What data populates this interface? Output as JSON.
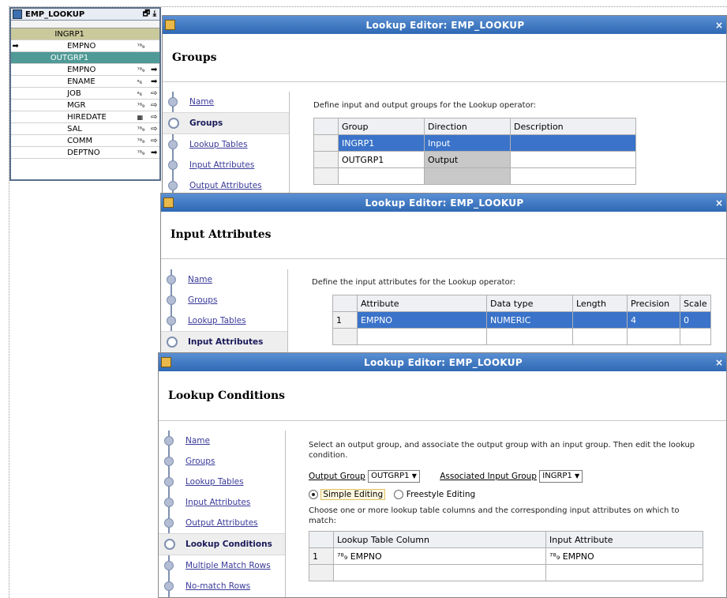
{
  "operator": {
    "title": "EMP_LOOKUP",
    "controls": "🗗 ⤓",
    "rows": [
      {
        "name": "INGRP1",
        "kind": "group-in",
        "type": "",
        "arrow": ""
      },
      {
        "name": "EMPNO",
        "kind": "attr",
        "type": "⁷⁸₉",
        "arrow": "",
        "lead": "➡"
      },
      {
        "name": "OUTGRP1",
        "kind": "group-out",
        "type": "",
        "arrow": ""
      },
      {
        "name": "EMPNO",
        "kind": "attr",
        "type": "⁷⁸₉",
        "arrow": "➡"
      },
      {
        "name": "ENAME",
        "kind": "attr",
        "type": "ᵃ₆",
        "arrow": "➡"
      },
      {
        "name": "JOB",
        "kind": "attr",
        "type": "ᵃ₆",
        "arrow": "⇨"
      },
      {
        "name": "MGR",
        "kind": "attr",
        "type": "⁷⁸₉",
        "arrow": "⇨"
      },
      {
        "name": "HIREDATE",
        "kind": "attr",
        "type": "▦",
        "arrow": "⇨"
      },
      {
        "name": "SAL",
        "kind": "attr",
        "type": "⁷⁸₉",
        "arrow": "⇨"
      },
      {
        "name": "COMM",
        "kind": "attr",
        "type": "⁷⁸₉",
        "arrow": "⇨"
      },
      {
        "name": "DEPTNO",
        "kind": "attr",
        "type": "⁷⁸₉",
        "arrow": "➡"
      }
    ]
  },
  "editor1": {
    "title": "Lookup Editor: EMP_LOOKUP",
    "heading": "Groups",
    "nav": [
      "Name",
      "Groups",
      "Lookup Tables",
      "Input Attributes",
      "Output Attributes"
    ],
    "selected": "Groups",
    "description": "Define input and output groups for the Lookup operator:",
    "columns": [
      "Group",
      "Direction",
      "Description"
    ],
    "rows": [
      {
        "group": "INGRP1",
        "direction": "Input",
        "description": ""
      },
      {
        "group": "OUTGRP1",
        "direction": "Output",
        "description": ""
      }
    ]
  },
  "editor2": {
    "title": "Lookup Editor: EMP_LOOKUP",
    "heading": "Input Attributes",
    "nav": [
      "Name",
      "Groups",
      "Lookup Tables",
      "Input Attributes"
    ],
    "selected": "Input Attributes",
    "description": "Define the input attributes for the Lookup operator:",
    "columns": [
      "Attribute",
      "Data type",
      "Length",
      "Precision",
      "Scale"
    ],
    "rows": [
      {
        "num": "1",
        "attribute": "EMPNO",
        "datatype": "NUMERIC",
        "length": "",
        "precision": "4",
        "scale": "0"
      }
    ]
  },
  "editor3": {
    "title": "Lookup Editor: EMP_LOOKUP",
    "heading": "Lookup Conditions",
    "nav": [
      "Name",
      "Groups",
      "Lookup Tables",
      "Input Attributes",
      "Output Attributes",
      "Lookup Conditions",
      "Multiple Match Rows",
      "No-match Rows"
    ],
    "selected": "Lookup Conditions",
    "description": "Select an output group, and associate the output group with an input group. Then edit the lookup condition.",
    "output_group_label": "Output Group",
    "output_group_value": "OUTGRP1",
    "assoc_group_label": "Associated Input Group",
    "assoc_group_value": "INGRP1",
    "simple_label": "Simple Editing",
    "freestyle_label": "Freestyle Editing",
    "choose_text": "Choose one or more lookup table columns and the corresponding input attributes on which to match:",
    "columns": [
      "Lookup Table Column",
      "Input Attribute"
    ],
    "rows": [
      {
        "num": "1",
        "column": "⁷⁸₉ EMPNO",
        "attribute": "⁷⁸₉ EMPNO"
      }
    ],
    "close_glyph": "×",
    "dropdown_glyph": "▼"
  }
}
